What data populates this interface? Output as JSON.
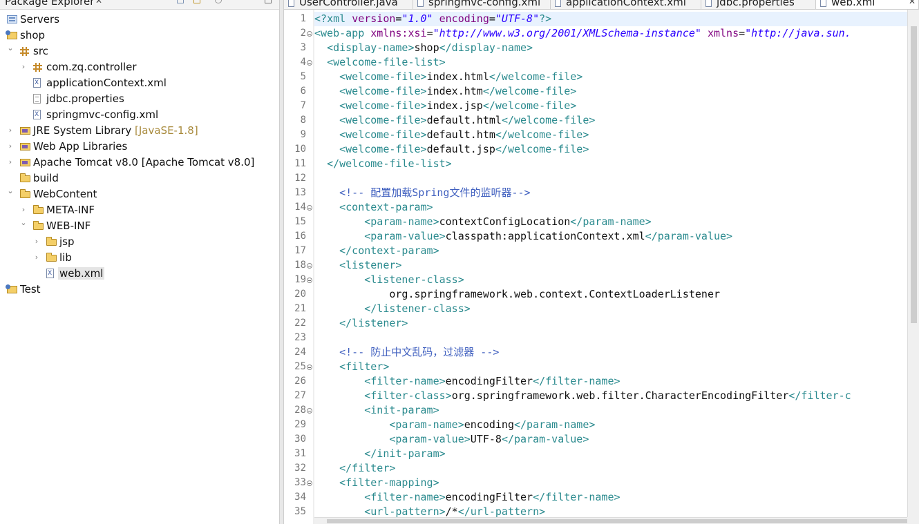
{
  "package_explorer": {
    "title": "Package Explorer",
    "close": "✕",
    "tree": [
      {
        "label": "Servers",
        "icon": "servers-project-icon",
        "depth": 0,
        "arrow": ""
      },
      {
        "label": "shop",
        "icon": "web-project-icon",
        "depth": 0,
        "arrow": ""
      },
      {
        "label": "src",
        "icon": "source-folder-icon",
        "depth": 1,
        "arrow": "expanded"
      },
      {
        "label": "com.zq.controller",
        "icon": "package-icon",
        "depth": 2,
        "arrow": "collapsed"
      },
      {
        "label": "applicationContext.xml",
        "icon": "xml-file-icon",
        "depth": 2,
        "arrow": ""
      },
      {
        "label": "jdbc.properties",
        "icon": "properties-file-icon",
        "depth": 2,
        "arrow": ""
      },
      {
        "label": "springmvc-config.xml",
        "icon": "xml-file-icon",
        "depth": 2,
        "arrow": ""
      },
      {
        "label": "JRE System Library",
        "decoration": "[JavaSE-1.8]",
        "icon": "library-icon",
        "depth": 1,
        "arrow": "collapsed"
      },
      {
        "label": "Web App Libraries",
        "icon": "library-icon",
        "depth": 1,
        "arrow": "collapsed"
      },
      {
        "label": "Apache Tomcat v8.0 [Apache Tomcat v8.0]",
        "icon": "library-icon",
        "depth": 1,
        "arrow": "collapsed"
      },
      {
        "label": "build",
        "icon": "folder-icon",
        "depth": 1,
        "arrow": ""
      },
      {
        "label": "WebContent",
        "icon": "folder-icon",
        "depth": 1,
        "arrow": "expanded"
      },
      {
        "label": "META-INF",
        "icon": "folder-icon",
        "depth": 2,
        "arrow": "collapsed"
      },
      {
        "label": "WEB-INF",
        "icon": "folder-icon",
        "depth": 2,
        "arrow": "expanded"
      },
      {
        "label": "jsp",
        "icon": "folder-icon",
        "depth": 3,
        "arrow": "collapsed"
      },
      {
        "label": "lib",
        "icon": "folder-icon",
        "depth": 3,
        "arrow": "collapsed"
      },
      {
        "label": "web.xml",
        "icon": "xml-file-icon",
        "depth": 3,
        "arrow": "",
        "selected": true
      },
      {
        "label": "Test",
        "icon": "project-icon",
        "depth": 0,
        "arrow": ""
      }
    ]
  },
  "editor": {
    "tabs": [
      {
        "label": "UserController.java",
        "icon": "java-file-icon"
      },
      {
        "label": "springmvc-config.xml",
        "icon": "xml-file-icon"
      },
      {
        "label": "applicationContext.xml",
        "icon": "xml-file-icon"
      },
      {
        "label": "jdbc.properties",
        "icon": "properties-file-icon"
      },
      {
        "label": "web.xml",
        "icon": "xml-file-icon",
        "active": true,
        "close": "✕"
      }
    ],
    "lines": [
      {
        "n": "1",
        "fold": false,
        "cur": true,
        "tokens": [
          [
            "tag",
            "<?"
          ],
          [
            "tag",
            "xml "
          ],
          [
            "attr",
            "version"
          ],
          [
            "text",
            "="
          ],
          [
            "val",
            "\"1.0\""
          ],
          [
            "text",
            " "
          ],
          [
            "attr",
            "encoding"
          ],
          [
            "text",
            "="
          ],
          [
            "val",
            "\"UTF-8\""
          ],
          [
            "tag",
            "?>"
          ]
        ]
      },
      {
        "n": "2",
        "fold": true,
        "tokens": [
          [
            "tag",
            "<web-app "
          ],
          [
            "attr",
            "xmlns:xsi"
          ],
          [
            "text",
            "="
          ],
          [
            "val",
            "\"http://www.w3.org/2001/XMLSchema-instance\""
          ],
          [
            "text",
            " "
          ],
          [
            "attr",
            "xmlns"
          ],
          [
            "text",
            "="
          ],
          [
            "val",
            "\"http://java.sun."
          ]
        ]
      },
      {
        "n": "3",
        "fold": false,
        "tokens": [
          [
            "text",
            "  "
          ],
          [
            "tag",
            "<display-name>"
          ],
          [
            "text",
            "shop"
          ],
          [
            "tag",
            "</display-name>"
          ]
        ]
      },
      {
        "n": "4",
        "fold": true,
        "tokens": [
          [
            "text",
            "  "
          ],
          [
            "tag",
            "<welcome-file-list>"
          ]
        ]
      },
      {
        "n": "5",
        "fold": false,
        "tokens": [
          [
            "text",
            "    "
          ],
          [
            "tag",
            "<welcome-file>"
          ],
          [
            "text",
            "index.html"
          ],
          [
            "tag",
            "</welcome-file>"
          ]
        ]
      },
      {
        "n": "6",
        "fold": false,
        "tokens": [
          [
            "text",
            "    "
          ],
          [
            "tag",
            "<welcome-file>"
          ],
          [
            "text",
            "index.htm"
          ],
          [
            "tag",
            "</welcome-file>"
          ]
        ]
      },
      {
        "n": "7",
        "fold": false,
        "tokens": [
          [
            "text",
            "    "
          ],
          [
            "tag",
            "<welcome-file>"
          ],
          [
            "text",
            "index.jsp"
          ],
          [
            "tag",
            "</welcome-file>"
          ]
        ]
      },
      {
        "n": "8",
        "fold": false,
        "tokens": [
          [
            "text",
            "    "
          ],
          [
            "tag",
            "<welcome-file>"
          ],
          [
            "text",
            "default.html"
          ],
          [
            "tag",
            "</welcome-file>"
          ]
        ]
      },
      {
        "n": "9",
        "fold": false,
        "tokens": [
          [
            "text",
            "    "
          ],
          [
            "tag",
            "<welcome-file>"
          ],
          [
            "text",
            "default.htm"
          ],
          [
            "tag",
            "</welcome-file>"
          ]
        ]
      },
      {
        "n": "10",
        "fold": false,
        "tokens": [
          [
            "text",
            "    "
          ],
          [
            "tag",
            "<welcome-file>"
          ],
          [
            "text",
            "default.jsp"
          ],
          [
            "tag",
            "</welcome-file>"
          ]
        ]
      },
      {
        "n": "11",
        "fold": false,
        "tokens": [
          [
            "text",
            "  "
          ],
          [
            "tag",
            "</welcome-file-list>"
          ]
        ]
      },
      {
        "n": "12",
        "fold": false,
        "tokens": []
      },
      {
        "n": "13",
        "fold": false,
        "tokens": [
          [
            "text",
            "    "
          ],
          [
            "com",
            "<!-- 配置加载Spring文件的监听器-->"
          ]
        ]
      },
      {
        "n": "14",
        "fold": true,
        "tokens": [
          [
            "text",
            "    "
          ],
          [
            "tag",
            "<context-param>"
          ]
        ]
      },
      {
        "n": "15",
        "fold": false,
        "tokens": [
          [
            "text",
            "        "
          ],
          [
            "tag",
            "<param-name>"
          ],
          [
            "text",
            "contextConfigLocation"
          ],
          [
            "tag",
            "</param-name>"
          ]
        ]
      },
      {
        "n": "16",
        "fold": false,
        "tokens": [
          [
            "text",
            "        "
          ],
          [
            "tag",
            "<param-value>"
          ],
          [
            "text",
            "classpath:applicationContext.xml"
          ],
          [
            "tag",
            "</param-value>"
          ]
        ]
      },
      {
        "n": "17",
        "fold": false,
        "tokens": [
          [
            "text",
            "    "
          ],
          [
            "tag",
            "</context-param>"
          ]
        ]
      },
      {
        "n": "18",
        "fold": true,
        "tokens": [
          [
            "text",
            "    "
          ],
          [
            "tag",
            "<listener>"
          ]
        ]
      },
      {
        "n": "19",
        "fold": true,
        "tokens": [
          [
            "text",
            "        "
          ],
          [
            "tag",
            "<listener-class>"
          ]
        ]
      },
      {
        "n": "20",
        "fold": false,
        "tokens": [
          [
            "text",
            "            org.springframework.web.context.ContextLoaderListener"
          ]
        ]
      },
      {
        "n": "21",
        "fold": false,
        "tokens": [
          [
            "text",
            "        "
          ],
          [
            "tag",
            "</listener-class>"
          ]
        ]
      },
      {
        "n": "22",
        "fold": false,
        "tokens": [
          [
            "text",
            "    "
          ],
          [
            "tag",
            "</listener>"
          ]
        ]
      },
      {
        "n": "23",
        "fold": false,
        "tokens": []
      },
      {
        "n": "24",
        "fold": false,
        "tokens": [
          [
            "text",
            "    "
          ],
          [
            "com",
            "<!-- 防止中文乱码，过滤器 -->"
          ]
        ]
      },
      {
        "n": "25",
        "fold": true,
        "tokens": [
          [
            "text",
            "    "
          ],
          [
            "tag",
            "<filter>"
          ]
        ]
      },
      {
        "n": "26",
        "fold": false,
        "tokens": [
          [
            "text",
            "        "
          ],
          [
            "tag",
            "<filter-name>"
          ],
          [
            "text",
            "encodingFilter"
          ],
          [
            "tag",
            "</filter-name>"
          ]
        ]
      },
      {
        "n": "27",
        "fold": false,
        "tokens": [
          [
            "text",
            "        "
          ],
          [
            "tag",
            "<filter-class>"
          ],
          [
            "text",
            "org.springframework.web.filter.CharacterEncodingFilter"
          ],
          [
            "tag",
            "</filter-c"
          ]
        ]
      },
      {
        "n": "28",
        "fold": true,
        "tokens": [
          [
            "text",
            "        "
          ],
          [
            "tag",
            "<init-param>"
          ]
        ]
      },
      {
        "n": "29",
        "fold": false,
        "tokens": [
          [
            "text",
            "            "
          ],
          [
            "tag",
            "<param-name>"
          ],
          [
            "text",
            "encoding"
          ],
          [
            "tag",
            "</param-name>"
          ]
        ]
      },
      {
        "n": "30",
        "fold": false,
        "tokens": [
          [
            "text",
            "            "
          ],
          [
            "tag",
            "<param-value>"
          ],
          [
            "text",
            "UTF-8"
          ],
          [
            "tag",
            "</param-value>"
          ]
        ]
      },
      {
        "n": "31",
        "fold": false,
        "tokens": [
          [
            "text",
            "        "
          ],
          [
            "tag",
            "</init-param>"
          ]
        ]
      },
      {
        "n": "32",
        "fold": false,
        "tokens": [
          [
            "text",
            "    "
          ],
          [
            "tag",
            "</filter>"
          ]
        ]
      },
      {
        "n": "33",
        "fold": true,
        "tokens": [
          [
            "text",
            "    "
          ],
          [
            "tag",
            "<filter-mapping>"
          ]
        ]
      },
      {
        "n": "34",
        "fold": false,
        "tokens": [
          [
            "text",
            "        "
          ],
          [
            "tag",
            "<filter-name>"
          ],
          [
            "text",
            "encodingFilter"
          ],
          [
            "tag",
            "</filter-name>"
          ]
        ]
      },
      {
        "n": "35",
        "fold": false,
        "tokens": [
          [
            "text",
            "        "
          ],
          [
            "tag",
            "<url-pattern>"
          ],
          [
            "text",
            "/*"
          ],
          [
            "tag",
            "</url-pattern>"
          ]
        ]
      }
    ]
  },
  "colors": {
    "tag": "#2a8a8e",
    "attr": "#7f007f",
    "value": "#2a00ff",
    "comment": "#3f5fbf",
    "text": "#111111"
  }
}
